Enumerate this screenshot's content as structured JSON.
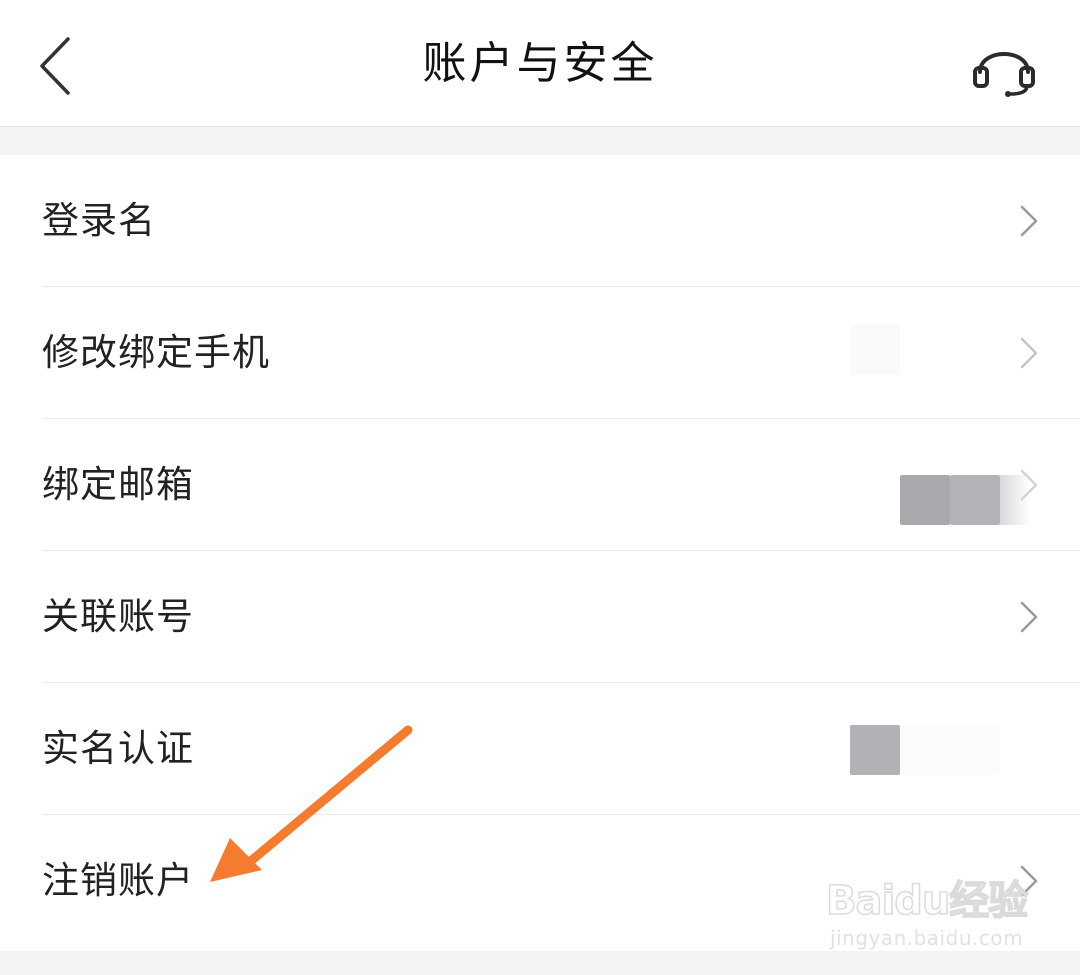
{
  "header": {
    "title": "账户与安全",
    "back_icon": "chevron-left-icon",
    "service_icon": "headset-icon"
  },
  "menu": {
    "items": [
      {
        "label": "登录名"
      },
      {
        "label": "修改绑定手机"
      },
      {
        "label": "绑定邮箱"
      },
      {
        "label": "关联账号"
      },
      {
        "label": "实名认证"
      },
      {
        "label": "注销账户"
      }
    ],
    "chevron_icon": "chevron-right-icon"
  },
  "annotation": {
    "arrow_color": "#f57c2e"
  },
  "watermark": {
    "logo": "Baidu经验",
    "url": "jingyan.baidu.com"
  }
}
